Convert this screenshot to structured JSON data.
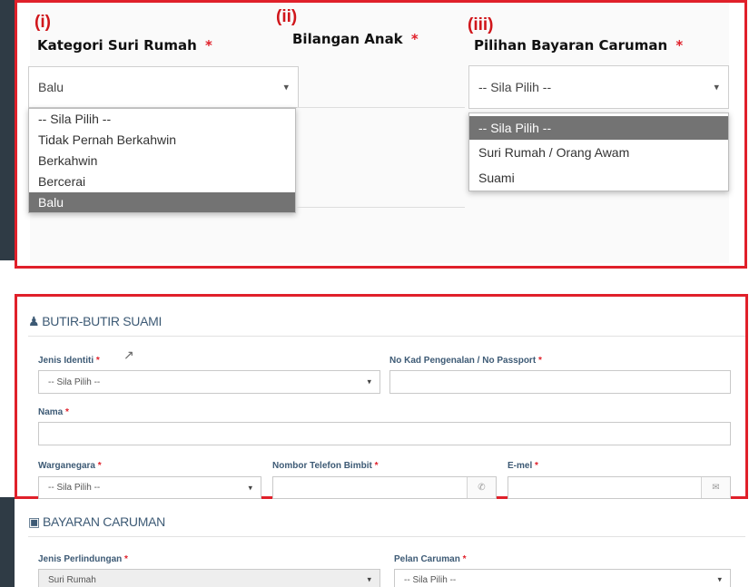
{
  "top_panel": {
    "col1": {
      "marker": "(i)",
      "label": "Kategori Suri Rumah",
      "required": "*",
      "selected": "Balu",
      "options": [
        "-- Sila Pilih --",
        "Tidak Pernah Berkahwin",
        "Berkahwin",
        "Bercerai",
        "Balu"
      ],
      "highlighted_index": 4
    },
    "col2": {
      "marker": "(ii)",
      "label": "Bilangan Anak",
      "required": "*"
    },
    "col3": {
      "marker": "(iii)",
      "label": "Pilihan Bayaran Caruman",
      "required": "*",
      "selected": "-- Sila Pilih --",
      "options": [
        "-- Sila Pilih --",
        "Suri Rumah / Orang Awam",
        "Suami"
      ],
      "highlighted_index": 0
    }
  },
  "husband_section": {
    "title": "BUTIR-BUTIR SUAMI",
    "icon": "user-icon",
    "fields": {
      "jenis_identiti": {
        "label": "Jenis Identiti",
        "required": "*",
        "value": "-- Sila Pilih --"
      },
      "no_kad": {
        "label": "No Kad Pengenalan / No Passport",
        "required": "*",
        "value": ""
      },
      "nama": {
        "label": "Nama",
        "required": "*",
        "value": ""
      },
      "warganegara": {
        "label": "Warganegara",
        "required": "*",
        "value": "-- Sila Pilih --"
      },
      "telefon": {
        "label": "Nombor Telefon Bimbit",
        "required": "*",
        "value": "",
        "icon": "phone-icon"
      },
      "emel": {
        "label": "E-mel",
        "required": "*",
        "value": "",
        "icon": "envelope-icon"
      }
    }
  },
  "payment_section": {
    "title": "BAYARAN CARUMAN",
    "icon": "money-icon",
    "fields": {
      "jenis_perlindungan": {
        "label": "Jenis Perlindungan",
        "required": "*",
        "value": "Suri Rumah"
      },
      "pelan_caruman": {
        "label": "Pelan Caruman",
        "required": "*",
        "value": "-- Sila Pilih --"
      }
    }
  },
  "colors": {
    "annotation_red": "#e0202a",
    "label_blue": "#3d5a75",
    "highlight_gray": "#737373"
  }
}
